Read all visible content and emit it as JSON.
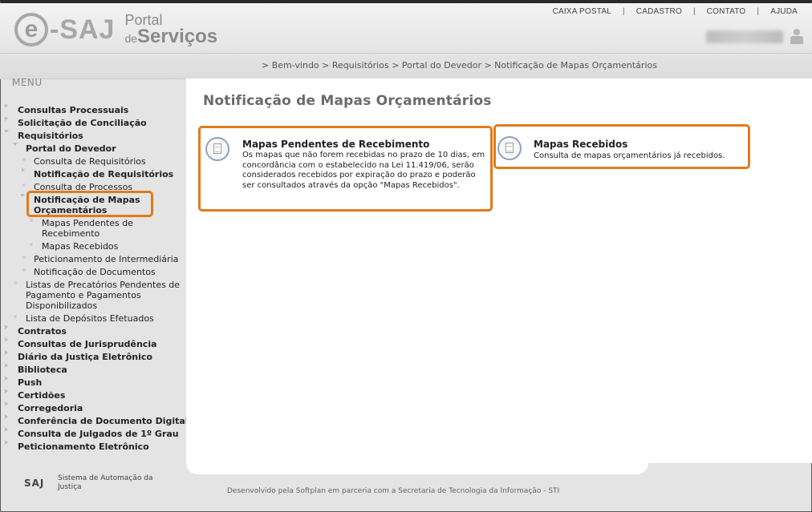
{
  "header": {
    "logo": {
      "e": "e",
      "saj": "-SAJ",
      "portal": "Portal",
      "de": "de",
      "servicos": "Serviços"
    },
    "topnav": [
      "CAIXA POSTAL",
      "CADASTRO",
      "CONTATO",
      "AJUDA"
    ],
    "breadcrumb": [
      "> Bem-vindo",
      "> Requisitórios",
      "> Portal do Devedor",
      "> Notificação de Mapas Orçamentários"
    ]
  },
  "menu": {
    "title": "MENU",
    "items": [
      {
        "label": "Consultas Processuais"
      },
      {
        "label": "Solicitação de Conciliação"
      },
      {
        "label": "Requisitórios"
      },
      {
        "label": "Portal do Devedor"
      },
      {
        "label": "Consulta de Requisitórios"
      },
      {
        "label": "Notificação de Requisitórios"
      },
      {
        "label": "Consulta de Processos"
      },
      {
        "label": "Notificação de Mapas Orçamentários"
      },
      {
        "label": "Mapas Pendentes de Recebimento"
      },
      {
        "label": "Mapas Recebidos"
      },
      {
        "label": "Peticionamento de Intermediária"
      },
      {
        "label": "Notificação de Documentos"
      },
      {
        "label": "Listas de Precatórios Pendentes de Pagamento e Pagamentos Disponibilizados"
      },
      {
        "label": "Lista de Depósitos Efetuados"
      },
      {
        "label": "Contratos"
      },
      {
        "label": "Consultas de Jurisprudência"
      },
      {
        "label": "Diário da Justiça Eletrônico"
      },
      {
        "label": "Biblioteca"
      },
      {
        "label": "Push"
      },
      {
        "label": "Certidões"
      },
      {
        "label": "Corregedoria"
      },
      {
        "label": "Conferência de Documento Digital"
      },
      {
        "label": "Consulta de Julgados de 1º Grau"
      },
      {
        "label": "Peticionamento Eletrônico"
      }
    ]
  },
  "main": {
    "title": "Notificação de Mapas Orçamentários",
    "cards": [
      {
        "title": "Mapas Pendentes de Recebimento",
        "description": "Os mapas que não forem recebidas no prazo de 10 dias, em concordância com o estabelecido na Lei 11.419/06, serão considerados recebidos por expiração do prazo e poderão ser consultados através da opção \"Mapas Recebidos\"."
      },
      {
        "title": "Mapas Recebidos",
        "description": "Consulta de mapas orçamentários já recebidos."
      }
    ]
  },
  "footer": {
    "saj": "SAJ",
    "system": "Sistema de Automação da Justiça",
    "credit": "Desenvolvido pela Softplan em parceria com a Secretaria de Tecnologia da Informação - STI"
  },
  "colors": {
    "highlight": "#e27a1a",
    "background": "#e4e4e4"
  }
}
